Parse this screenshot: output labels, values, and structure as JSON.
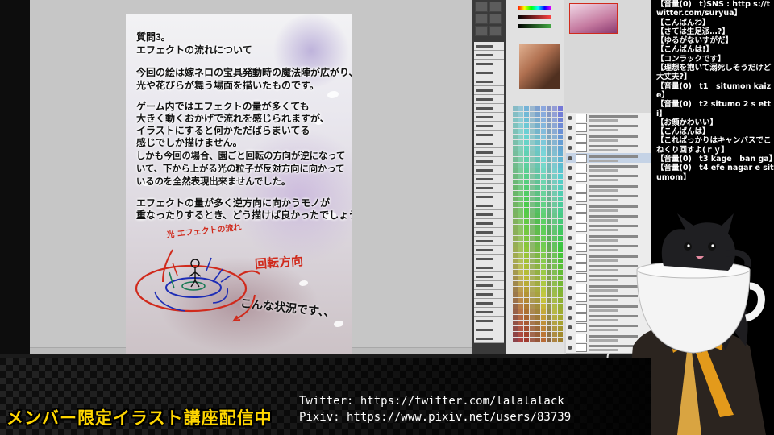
{
  "document": {
    "lines": [
      "質問3。",
      "エフェクトの流れについて",
      "今回の絵は嫁ネロの宝具発動時の魔法陣が広がり、",
      "光や花びらが舞う場面を描いたものです。",
      "ゲーム内ではエフェクトの量が多くても",
      "大きく動くおかげで流れを感じられますが、",
      "イラストにすると何かただばらまいてる",
      "感じでしか描けません。",
      "しかも今回の場合、園ごと回転の方向が逆になって",
      "いて、下から上がる光の粒子が反対方向に向かって",
      "いるのを全然表現出来ませんでした。",
      "エフェクトの量が多く逆方向に向かうモノが",
      "重なったりするとき、どう描けば良かったでしょう?"
    ],
    "handwriting": {
      "flow": "光 エフェクトの流れ",
      "rotation": "回転方向",
      "situation": "こんな状況です、、"
    }
  },
  "chat": {
    "messages": [
      "【音量(0)　t)SNS : http s://twitter.com/suryua】",
      "【こんばんわ】",
      "【さては生足派…?】",
      "【ゆるがないすがだ】",
      "【こんばんは!】",
      "【コンラックです】",
      "【理想を抱いて溺死しそうだけど大丈夫?】",
      "【音量(0)　t1　situmon kaize】",
      "【音量(0)　t2 situmo 2 s etti】",
      "【お顔かわいい】",
      "【こんばんは】",
      "【これぱっかりはキャンバスでこねくり回すよ(ｒｙ】",
      "【音量(0)　t3 kage　ban ga】",
      "【音量(0)　t4 efe nagar e situmom】"
    ]
  },
  "banner": {
    "title": "メンバー限定イラスト講座配信中",
    "twitter": "Twitter: https://twitter.com/lalalalack",
    "pixiv": "Pixiv: https://www.pixiv.net/users/83739"
  },
  "icons": [
    "cat-icon",
    "cup-icon",
    "eye-icon",
    "brush-icon"
  ],
  "colors": {
    "banner_title": "#ffd600",
    "annotation_red": "#d02a1c",
    "canvas_bg": "#c6c6c6"
  }
}
